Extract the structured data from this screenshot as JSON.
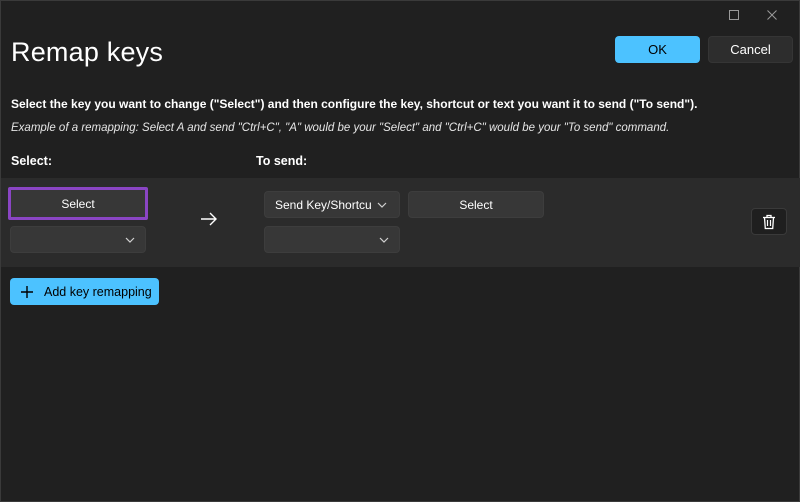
{
  "window": {
    "controls": [
      "maximize-icon",
      "close-icon"
    ]
  },
  "header": {
    "title": "Remap keys",
    "ok_label": "OK",
    "cancel_label": "Cancel"
  },
  "instructions": "Select the key you want to change (\"Select\") and then configure the key, shortcut or text you want it to send (\"To send\").",
  "example": "Example of a remapping: Select A and send \"Ctrl+C\", \"A\" would be your \"Select\" and \"Ctrl+C\" would be your \"To send\" command.",
  "columns": {
    "select": "Select:",
    "to_send": "To send:"
  },
  "row": {
    "select_button": "Select",
    "select_dropdown_value": "",
    "send_type": "Send Key/Shortcu",
    "send_select_button": "Select",
    "send_dropdown_value": ""
  },
  "add_button": "Add key remapping",
  "colors": {
    "accent": "#4cc2ff",
    "highlight": "#8a45c4",
    "background": "#202020"
  }
}
